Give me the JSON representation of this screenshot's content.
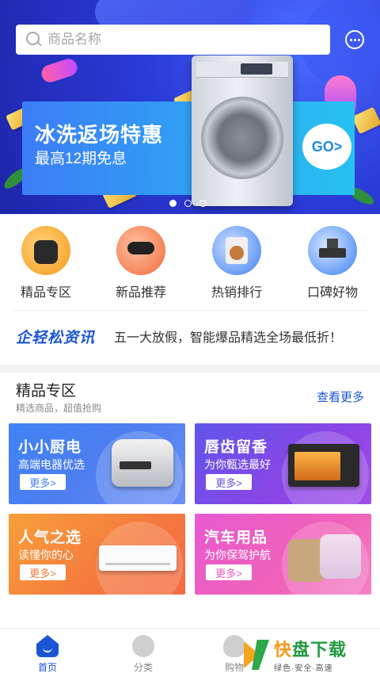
{
  "search": {
    "placeholder": "商品名称"
  },
  "banner": {
    "title": "冰洗返场特惠",
    "subtitle": "最高12期免息",
    "go_label": "GO>",
    "dots": [
      true,
      false,
      false
    ]
  },
  "categories": [
    {
      "label": "精品专区",
      "icon": "rice-cooker-icon"
    },
    {
      "label": "新品推荐",
      "icon": "hair-dryer-icon"
    },
    {
      "label": "热销排行",
      "icon": "washing-machine-icon"
    },
    {
      "label": "口碑好物",
      "icon": "range-hood-icon"
    }
  ],
  "news": {
    "logo": "企轻松资讯",
    "text": "五一大放假，智能爆品精选全场最低折！"
  },
  "section": {
    "title": "精品专区",
    "subtitle": "精选商品，超值抢购",
    "more_label": "查看更多"
  },
  "cards": [
    {
      "title": "小小厨电",
      "subtitle": "高端电器优选",
      "more": "更多>"
    },
    {
      "title": "唇齿留香",
      "subtitle": "为你甄选最好",
      "more": "更多>"
    },
    {
      "title": "人气之选",
      "subtitle": "读懂你的心",
      "more": "更多>"
    },
    {
      "title": "汽车用品",
      "subtitle": "为你保驾护航",
      "more": "更多>"
    }
  ],
  "tabbar": {
    "tabs": [
      {
        "label": "首页",
        "active": true
      },
      {
        "label": "分类",
        "active": false
      },
      {
        "label": "购物",
        "active": false
      }
    ]
  },
  "watermark": {
    "title_first": "快",
    "title_rest": "盘下载",
    "slogan": "绿色·安全·高速"
  },
  "colors": {
    "accent": "#1b55d4",
    "banner_bg": "#2b3bd8"
  }
}
